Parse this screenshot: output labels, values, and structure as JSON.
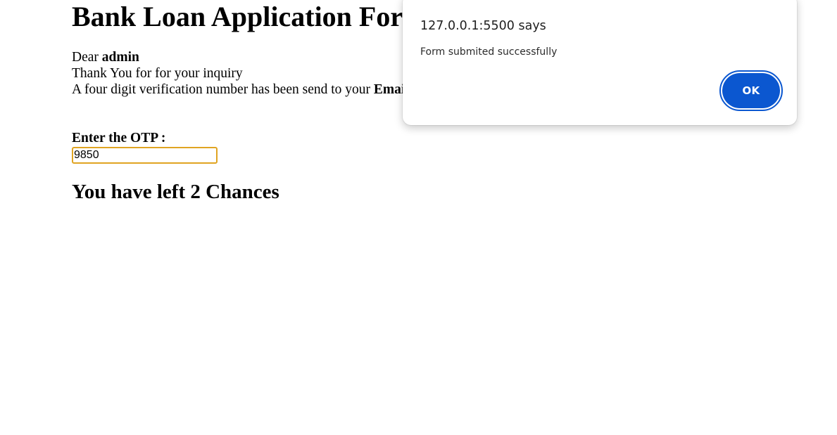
{
  "page": {
    "title": "Bank Loan Application Form",
    "greeting_prefix": "Dear ",
    "username": "admin",
    "thanks": "Thank You for for your inquiry",
    "verification_prefix": "A four digit verification number has been send to your ",
    "verification_channel": "Email",
    "otp_label": "Enter the OTP :",
    "otp_value": "9850",
    "chances": "You have left 2 Chances"
  },
  "dialog": {
    "origin": "127.0.0.1:5500 says",
    "message": "Form submited successfully",
    "ok_label": "OK"
  },
  "colors": {
    "accent": "#0b57d0",
    "input_focus_border": "#e0a422"
  }
}
